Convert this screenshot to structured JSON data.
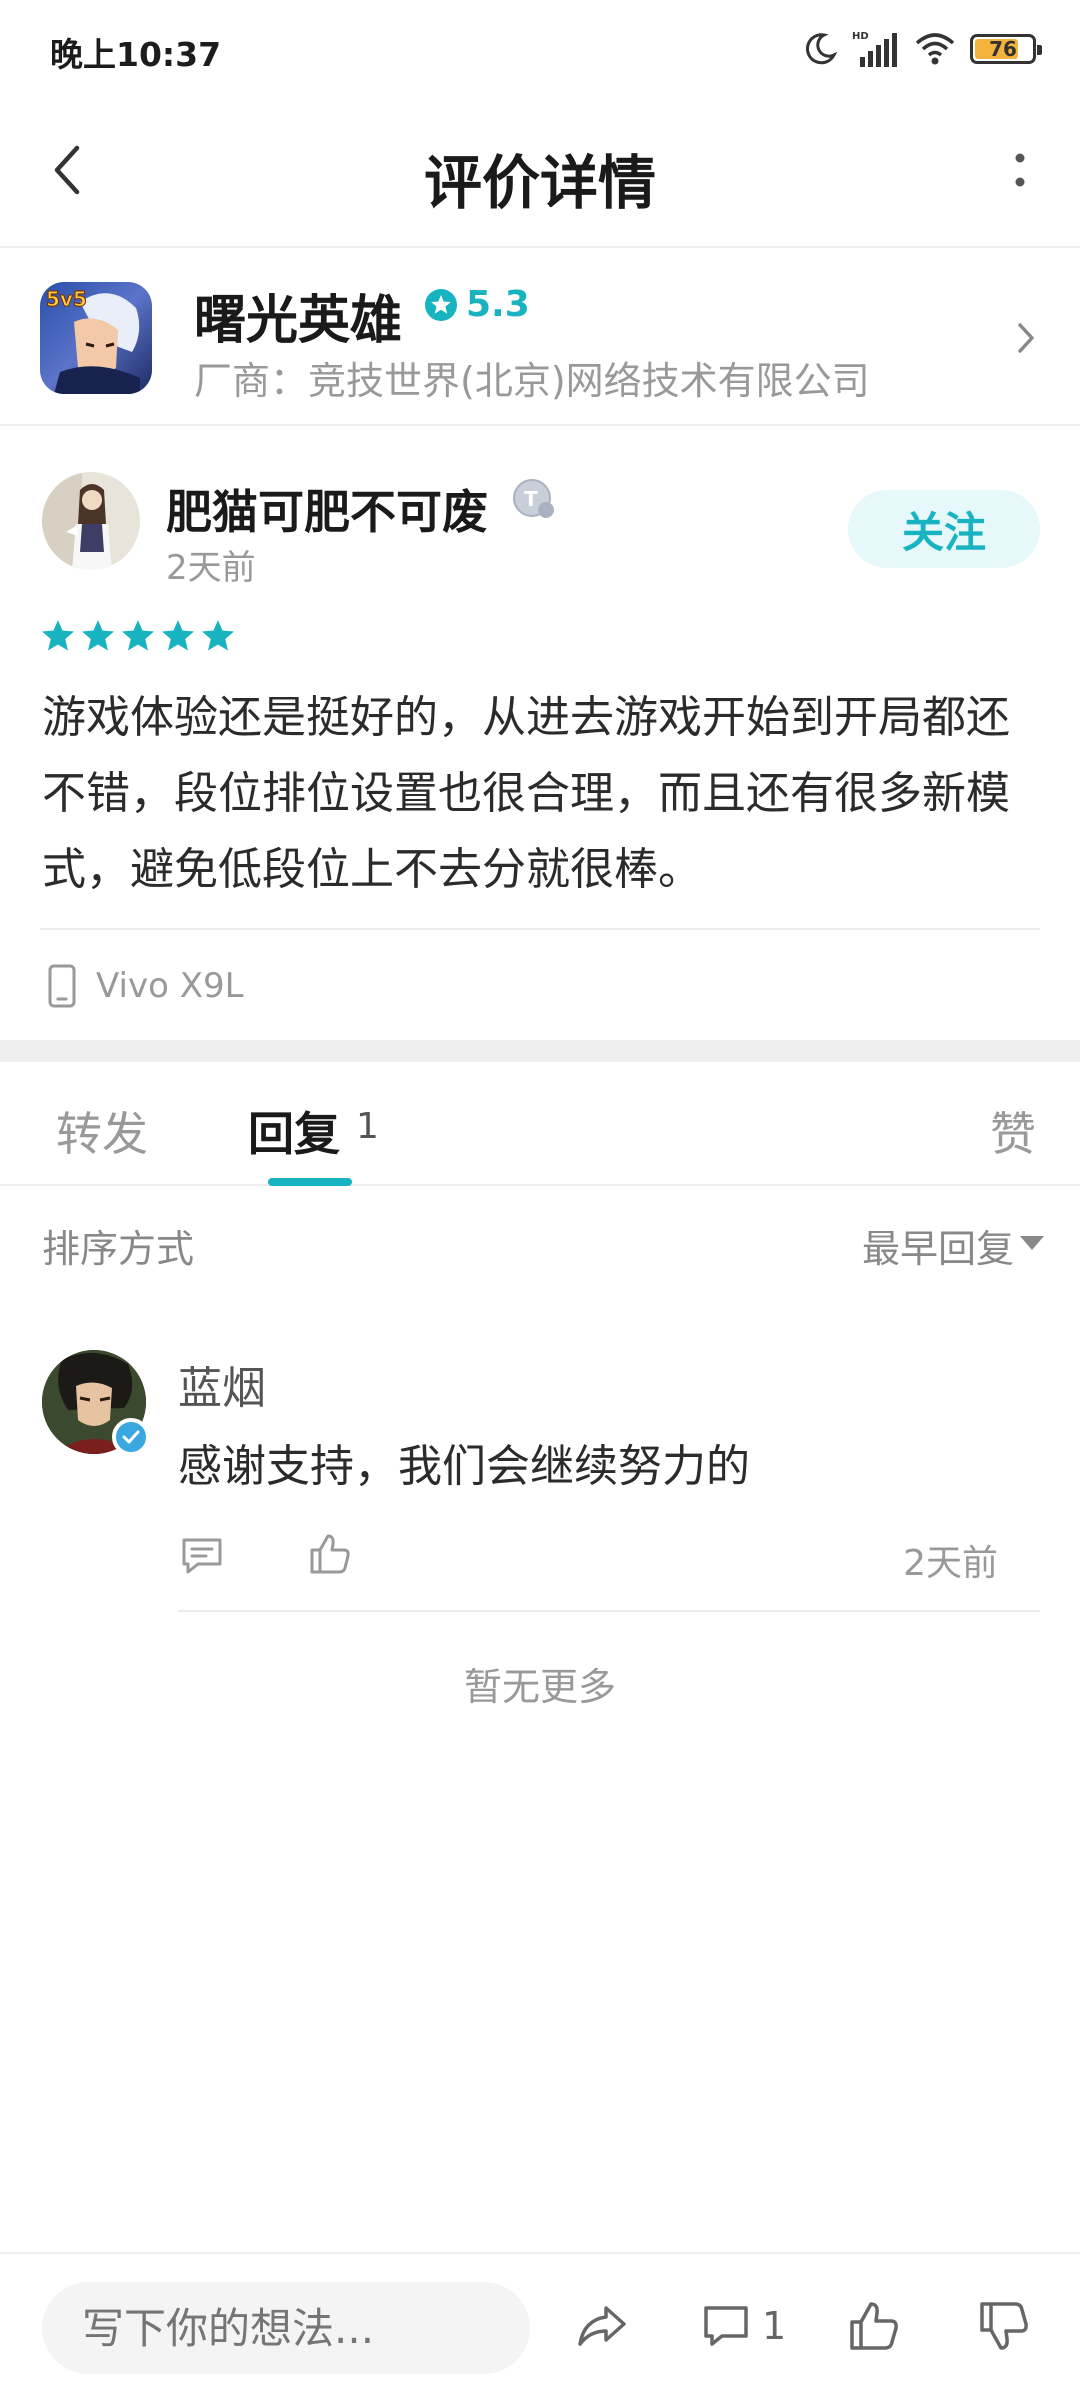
{
  "status_bar": {
    "time": "晚上10:37",
    "battery_level": "76",
    "battery_fraction": 0.76,
    "icons": [
      "moon-icon",
      "hd-signal-icon",
      "wifi-icon",
      "battery-icon"
    ]
  },
  "header": {
    "title": "评价详情",
    "back_icon": "chevron-left-icon",
    "more_icon": "more-vertical-icon"
  },
  "app": {
    "name": "曙光英雄",
    "rating": "5.3",
    "vendor": "厂商：竞技世界(北京)网络技术有限公司",
    "icon_text": "5v5"
  },
  "review": {
    "user_name": "肥猫可肥不可废",
    "badge_text": "T",
    "time": "2天前",
    "follow_label": "关注",
    "stars": 5,
    "text": "游戏体验还是挺好的，从进去游戏开始到开局都还不错，段位排位设置也很合理，而且还有很多新模式，避免低段位上不去分就很棒。",
    "device": "Vivo X9L"
  },
  "tabs": {
    "forward": "转发",
    "reply": "回复",
    "reply_count": "1",
    "like": "赞"
  },
  "sort": {
    "label": "排序方式",
    "value": "最早回复"
  },
  "reply": {
    "name": "蓝烟",
    "text": "感谢支持，我们会继续努力的",
    "time": "2天前"
  },
  "no_more": "暂无更多",
  "bottom_bar": {
    "input_placeholder": "写下你的想法...",
    "comment_count": "1"
  },
  "colors": {
    "accent": "#17b3c1",
    "follow_bg": "#e6f8f9",
    "battery": "#f3b33d"
  }
}
